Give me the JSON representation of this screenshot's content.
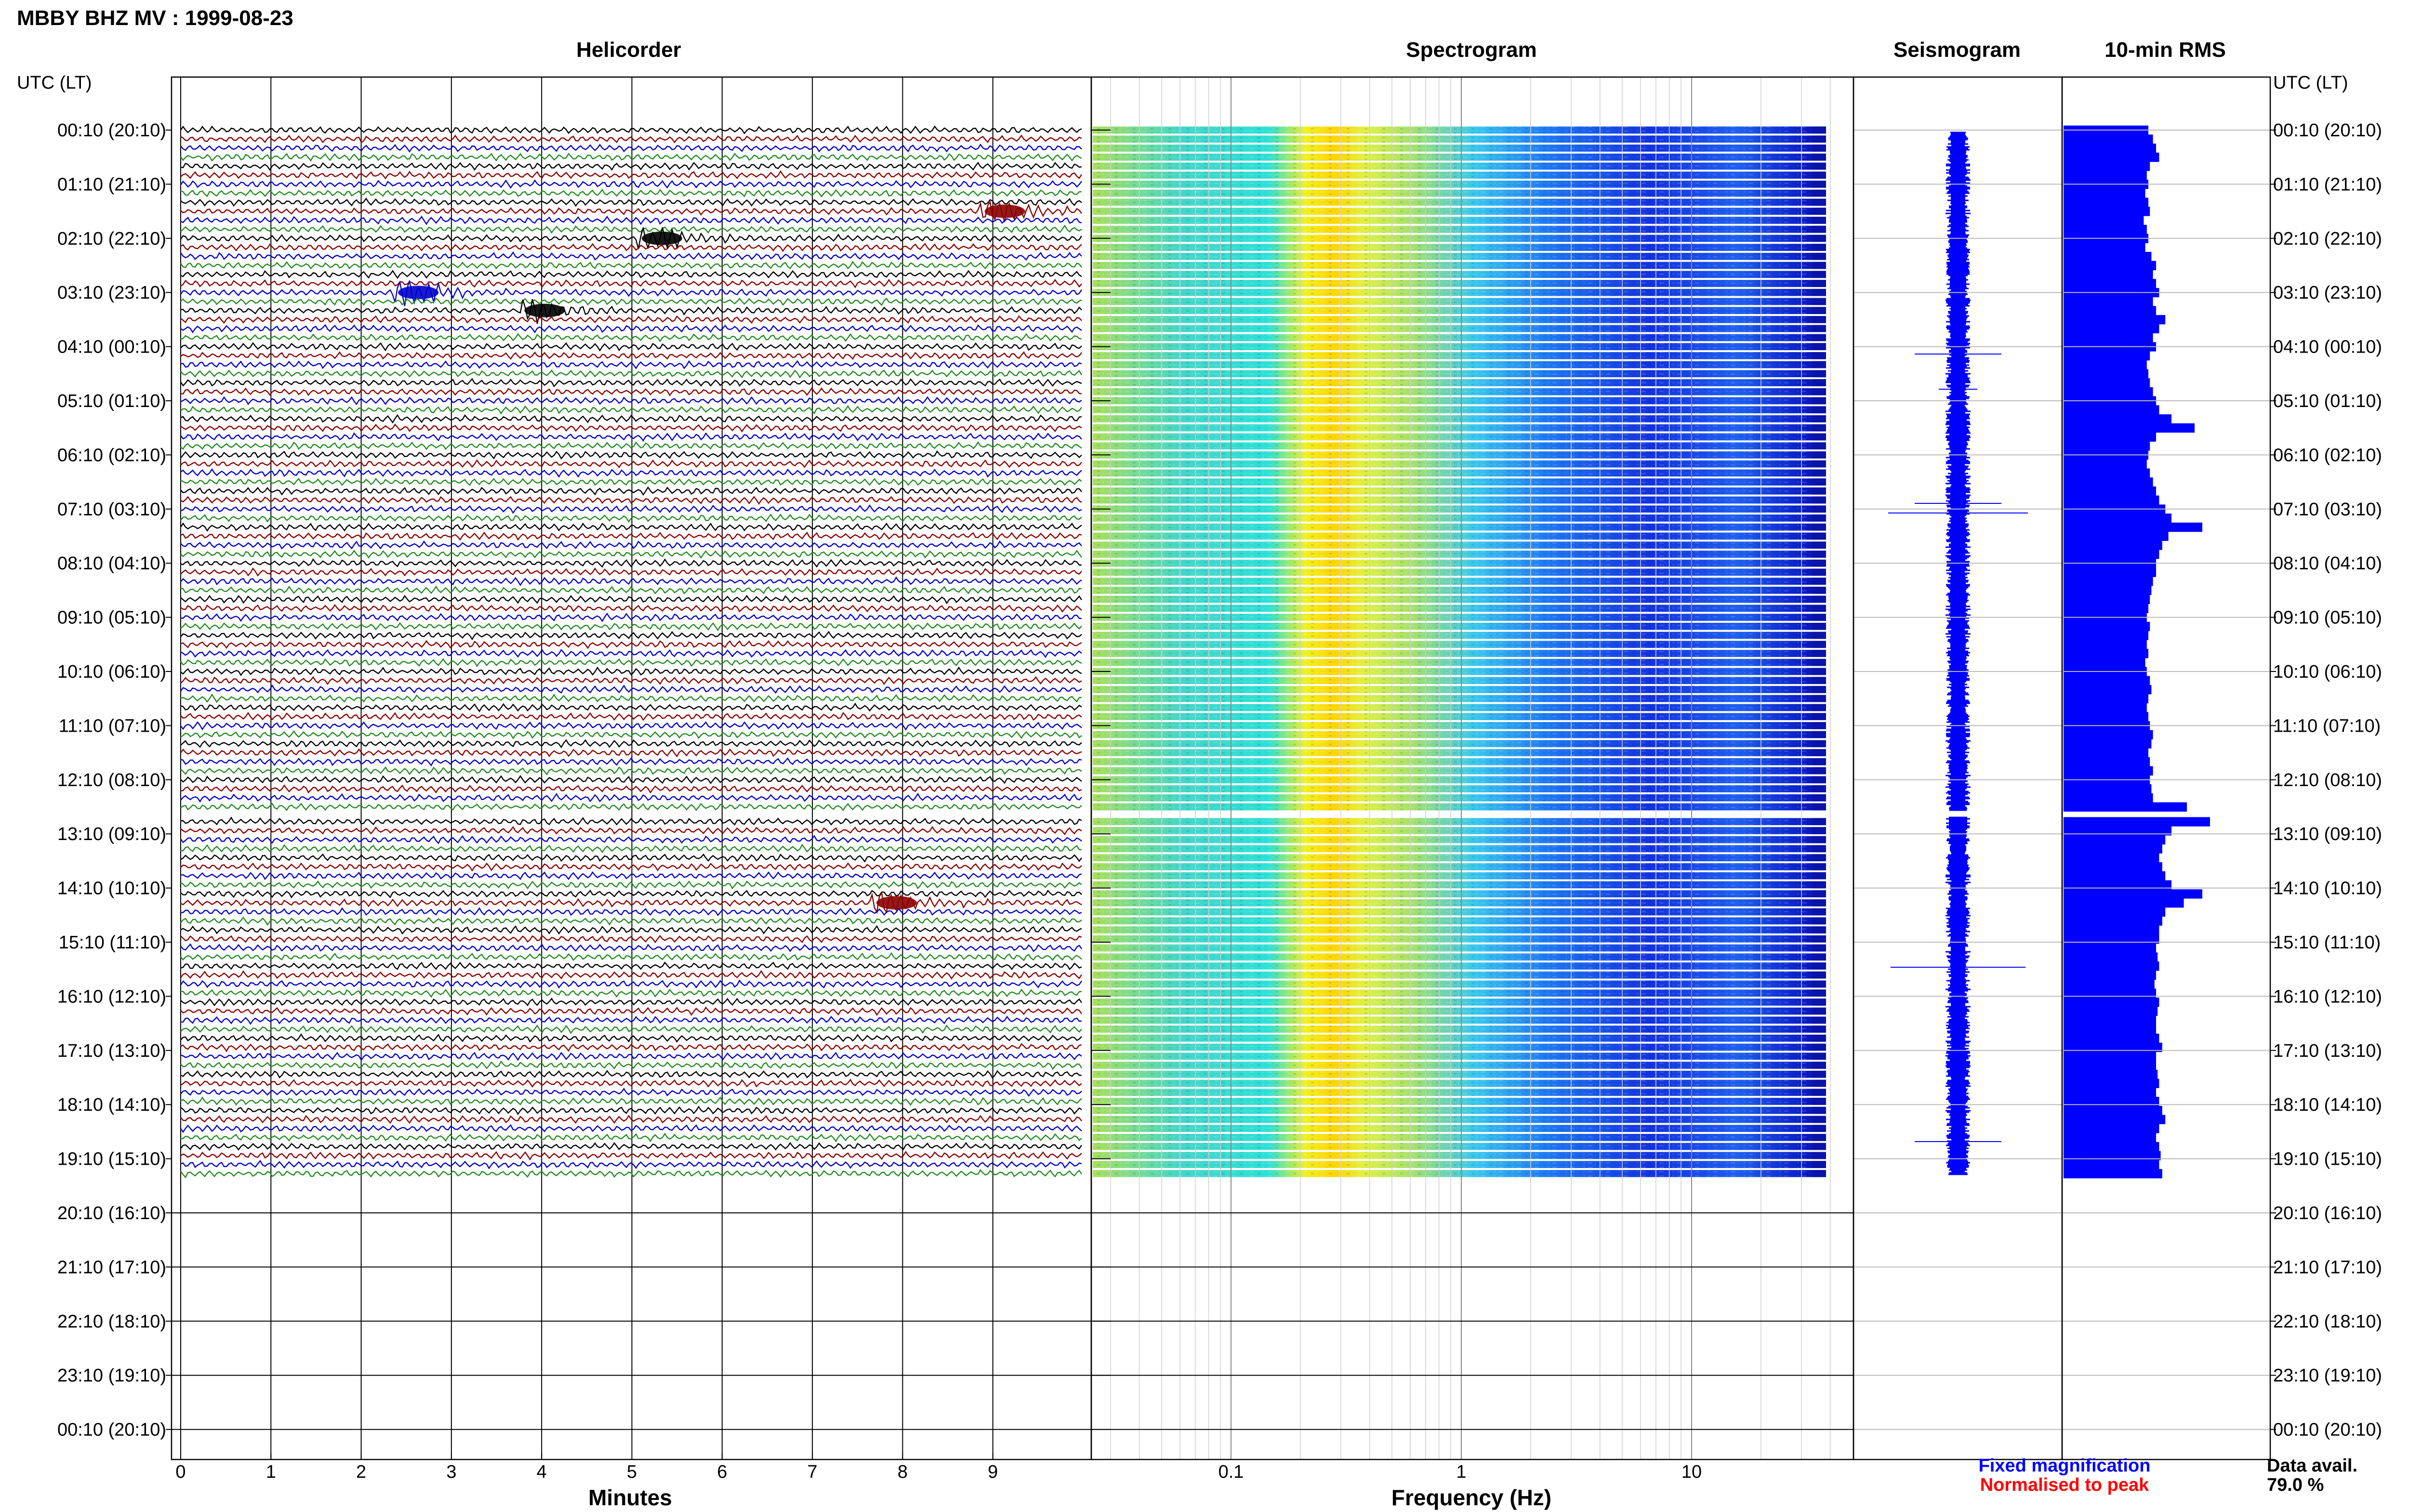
{
  "header": {
    "title": "MBBY BHZ MV : 1999-08-23",
    "left_axis_label": "UTC (LT)",
    "right_axis_label": "UTC (LT)"
  },
  "columns": {
    "helicorder": "Helicorder",
    "spectrogram": "Spectrogram",
    "seismogram": "Seismogram",
    "rms": "10-min RMS"
  },
  "time_ticks": [
    "00:10 (20:10)",
    "01:10 (21:10)",
    "02:10 (22:10)",
    "03:10 (23:10)",
    "04:10 (00:10)",
    "05:10 (01:10)",
    "06:10 (02:10)",
    "07:10 (03:10)",
    "08:10 (04:10)",
    "09:10 (05:10)",
    "10:10 (06:10)",
    "11:10 (07:10)",
    "12:10 (08:10)",
    "13:10 (09:10)",
    "14:10 (10:10)",
    "15:10 (11:10)",
    "16:10 (12:10)",
    "17:10 (13:10)",
    "18:10 (14:10)",
    "19:10 (15:10)",
    "20:10 (16:10)",
    "21:10 (17:10)",
    "22:10 (18:10)",
    "23:10 (19:10)",
    "00:10 (20:10)"
  ],
  "minutes_ticks": [
    "0",
    "1",
    "2",
    "3",
    "4",
    "5",
    "6",
    "7",
    "8",
    "9"
  ],
  "freq_ticks": [
    "0.1",
    "1",
    "10"
  ],
  "x_axis_titles": {
    "helicorder": "Minutes",
    "spectrogram": "Frequency (Hz)"
  },
  "legend": {
    "fixed": "Fixed magnification",
    "normalised": "Normalised to peak"
  },
  "availability": {
    "label": "Data avail.",
    "value": "79.0 %"
  },
  "colors": {
    "trace_cycle": [
      "#000000",
      "#8b0000",
      "#0000cc",
      "#228b22"
    ],
    "fixed_magnification": "#0000ff",
    "normalised_to_peak": "#ff0000",
    "rms_bars": "#0000ff"
  },
  "chart_data": {
    "type": "heatmap",
    "time_axis": "UTC hours, 10-minute lines",
    "minutes_range": [
      0,
      10
    ],
    "frequency_range_hz": [
      0.03,
      40
    ],
    "frequency_scale": "log",
    "data_rows_10min": 116,
    "gap_after_row": 75,
    "events_helicorder": [
      {
        "row": 9,
        "minute": 9.0
      },
      {
        "row": 12,
        "minute": 5.2
      },
      {
        "row": 18,
        "minute": 2.5
      },
      {
        "row": 20,
        "minute": 3.9
      },
      {
        "row": 85,
        "minute": 7.8
      }
    ],
    "rms_10min_relative": [
      0.55,
      0.58,
      0.6,
      0.62,
      0.56,
      0.54,
      0.55,
      0.53,
      0.55,
      0.56,
      0.52,
      0.54,
      0.55,
      0.53,
      0.57,
      0.6,
      0.58,
      0.6,
      0.62,
      0.58,
      0.6,
      0.66,
      0.62,
      0.58,
      0.6,
      0.56,
      0.54,
      0.55,
      0.56,
      0.58,
      0.6,
      0.62,
      0.7,
      0.85,
      0.6,
      0.56,
      0.55,
      0.54,
      0.56,
      0.58,
      0.6,
      0.62,
      0.66,
      0.7,
      0.9,
      0.68,
      0.64,
      0.62,
      0.6,
      0.6,
      0.58,
      0.57,
      0.56,
      0.55,
      0.54,
      0.56,
      0.55,
      0.54,
      0.55,
      0.53,
      0.54,
      0.56,
      0.57,
      0.55,
      0.54,
      0.55,
      0.56,
      0.58,
      0.57,
      0.55,
      0.56,
      0.58,
      0.56,
      0.57,
      0.58,
      0.8,
      0.95,
      0.7,
      0.66,
      0.64,
      0.62,
      0.64,
      0.66,
      0.7,
      0.9,
      0.78,
      0.66,
      0.64,
      0.62,
      0.62,
      0.6,
      0.61,
      0.62,
      0.6,
      0.59,
      0.6,
      0.62,
      0.61,
      0.6,
      0.6,
      0.62,
      0.64,
      0.6,
      0.6,
      0.61,
      0.62,
      0.6,
      0.62,
      0.64,
      0.66,
      0.62,
      0.6,
      0.62,
      0.63,
      0.62,
      0.64
    ]
  }
}
